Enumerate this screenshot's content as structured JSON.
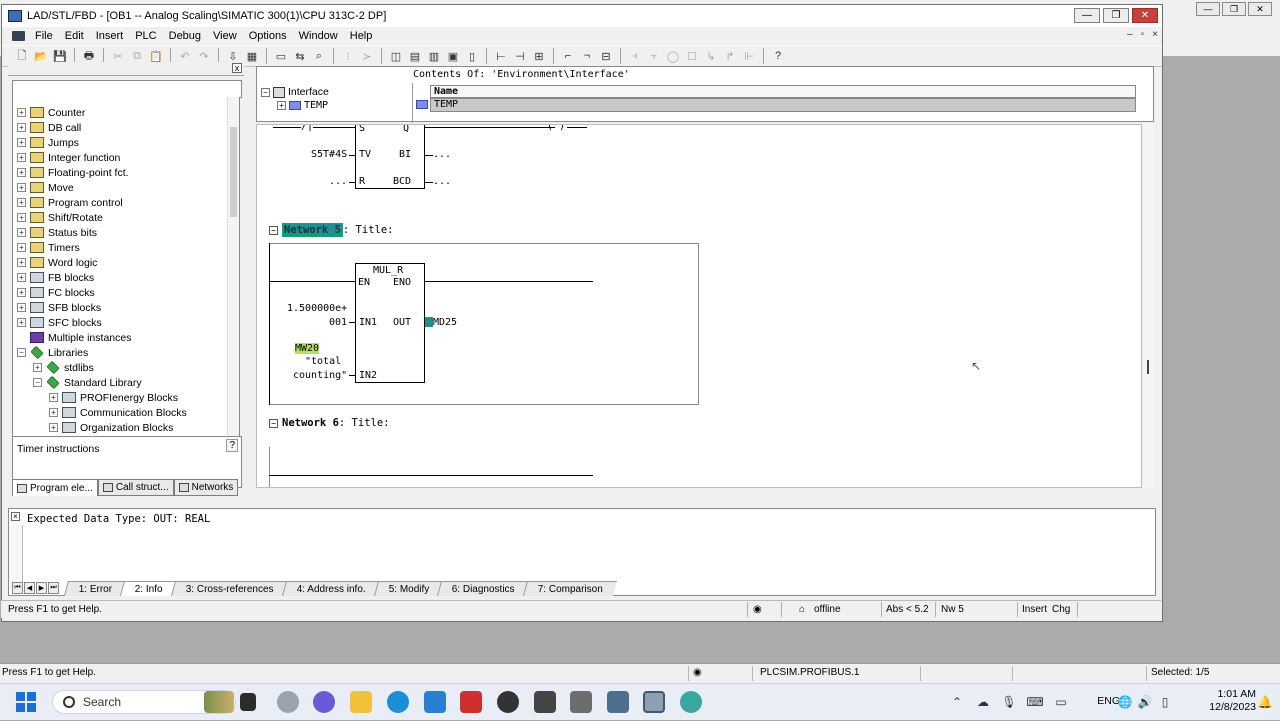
{
  "window": {
    "title": "LAD/STL/FBD  - [OB1 -- Analog Scaling\\SIMATIC 300(1)\\CPU 313C-2 DP]",
    "minimize": "—",
    "restore": "❐",
    "close": "✕"
  },
  "menu": {
    "items": [
      "File",
      "Edit",
      "Insert",
      "PLC",
      "Debug",
      "View",
      "Options",
      "Window",
      "Help"
    ],
    "right": [
      "–",
      "▫",
      "×"
    ]
  },
  "left_pane": {
    "close": "x",
    "tree": [
      {
        "label": "Counter",
        "icon": "folder-icon"
      },
      {
        "label": "DB call",
        "icon": "folder-icon"
      },
      {
        "label": "Jumps",
        "icon": "folder-icon"
      },
      {
        "label": "Integer function",
        "icon": "folder-icon"
      },
      {
        "label": "Floating-point fct.",
        "icon": "folder-icon"
      },
      {
        "label": "Move",
        "icon": "folder-icon"
      },
      {
        "label": "Program control",
        "icon": "folder-icon"
      },
      {
        "label": "Shift/Rotate",
        "icon": "folder-icon"
      },
      {
        "label": "Status bits",
        "icon": "folder-icon"
      },
      {
        "label": "Timers",
        "icon": "folder-icon"
      },
      {
        "label": "Word logic",
        "icon": "folder-icon"
      },
      {
        "label": "FB blocks",
        "icon": "block-icon"
      },
      {
        "label": "FC blocks",
        "icon": "block-icon"
      },
      {
        "label": "SFB blocks",
        "icon": "block-icon"
      },
      {
        "label": "SFC blocks",
        "icon": "block-icon"
      },
      {
        "label": "Multiple instances",
        "icon": "multi-icon"
      },
      {
        "label": "Libraries",
        "icon": "library-icon"
      },
      {
        "label": "stdlibs",
        "icon": "library-icon"
      },
      {
        "label": "Standard Library",
        "icon": "library-icon"
      },
      {
        "label": "PROFIenergy Blocks",
        "icon": "block-icon"
      },
      {
        "label": "Communication Blocks",
        "icon": "block-icon"
      },
      {
        "label": "Organization Blocks",
        "icon": "block-icon"
      }
    ],
    "info_text": "Timer instructions",
    "help_btn": "?",
    "tabs": [
      "Program ele...",
      "Call struct...",
      "Networks"
    ]
  },
  "interface": {
    "contents_of": "Contents Of:  'Environment\\Interface'",
    "tree_root": "Interface",
    "tree_child": "TEMP",
    "col_name": "Name",
    "row": "TEMP"
  },
  "ladder": {
    "prev_network": {
      "timer_tv_param": "S5T#4S",
      "pin_s": "S",
      "pin_q": "Q",
      "pin_tv": "TV",
      "pin_bi": "BI",
      "pin_r": "R",
      "pin_bcd": "BCD",
      "bi_out": "...",
      "r_in": "...",
      "bcd_out": "...",
      "coil_frag": "( )"
    },
    "network5": {
      "label": "Network 5",
      "title": ": Title:",
      "block_name": "MUL_R",
      "pin_en": "EN",
      "pin_eno": "ENO",
      "pin_in1": "IN1",
      "pin_out": "OUT",
      "pin_in2": "IN2",
      "in1_val_line1": "1.500000e+",
      "in1_val_line2": "001",
      "out_val": "MD25",
      "in2_addr": "MW20",
      "in2_sym_line1": "\"total",
      "in2_sym_line2": "counting\""
    },
    "network6": {
      "label": "Network 6",
      "title": ": Title:"
    }
  },
  "output": {
    "message": "Expected Data Type: OUT: REAL",
    "tabs": [
      "1: Error",
      "2: Info",
      "3: Cross-references",
      "4: Address info.",
      "5: Modify",
      "6: Diagnostics",
      "7: Comparison"
    ],
    "active_tab": "2: Info"
  },
  "statusbar": {
    "help": "Press F1 to get Help.",
    "mode": "offline",
    "abs": "Abs < 5.2",
    "nw": "Nw 5",
    "insert": "Insert",
    "chg": "Chg"
  },
  "outer_statusbar": {
    "help": "Press F1 to get Help.",
    "interface": "PLCSIM.PROFIBUS.1",
    "selected": "Selected: 1/5"
  },
  "taskbar": {
    "search": "Search",
    "lang": "ENG",
    "time": "1:01 AM",
    "date": "12/8/2023"
  }
}
